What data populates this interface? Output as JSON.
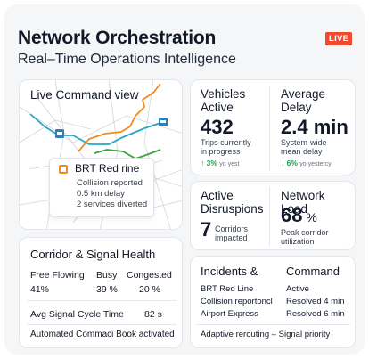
{
  "header": {
    "title": "Network Orchestration",
    "subtitle": "Real–Time Operations Intelligence",
    "live_badge": "LIVE"
  },
  "map_card": {
    "title": "Live Command view",
    "tooltip": {
      "title": "BRT Red rine",
      "lines": [
        "Collision reported",
        "0.5 km delay",
        "2 services diverted"
      ]
    },
    "colors": {
      "cyan_line": "#2aa7c4",
      "orange_line": "#f28a1e",
      "green_line": "#3fa04a",
      "station": "#2f7fb6"
    }
  },
  "vehicles": {
    "title_line1": "Vehicles",
    "title_line2": "Active",
    "value": "432",
    "sub_line1": "Trips currently",
    "sub_line2": "in progress",
    "trend_value": "↑ 3%",
    "trend_label": "yo yest"
  },
  "delay": {
    "title_line1": "Average",
    "title_line2": "Delay",
    "value": "2.4 min",
    "sub_line1": "System-wide",
    "sub_line2": "mean delay",
    "trend_value": "↓ 6%",
    "trend_label": "yo yestercy"
  },
  "disruptions": {
    "title_line1": "Active",
    "title_line2": "Disruspions",
    "value": "7",
    "sub_line1": "Corridors",
    "sub_line2": "impacted"
  },
  "network_load": {
    "title": "Network Load",
    "value": "68",
    "unit": "%",
    "sub_line1": "Peak corridor",
    "sub_line2": "utilization"
  },
  "corridor": {
    "title": "Corridor & Signal Health",
    "headers": [
      "Free Flowing",
      "Busy",
      "Congested"
    ],
    "values": [
      "41%",
      "39 %",
      "20 %"
    ],
    "signal_label": "Avg Signal Cycle Time",
    "signal_value": "82 s",
    "footer": "Automated Commaci Book activated"
  },
  "incidents": {
    "title": "Incidents &",
    "title2": "Command",
    "rows": [
      {
        "name": "BRT Red Line",
        "status": "Active"
      },
      {
        "name": "Collision reportoncl",
        "status": "Resolved 4 min"
      },
      {
        "name": "Airport Express",
        "status": "Resolved 6 min"
      }
    ],
    "footer": "Adaptive rerouting – Signal priority"
  }
}
